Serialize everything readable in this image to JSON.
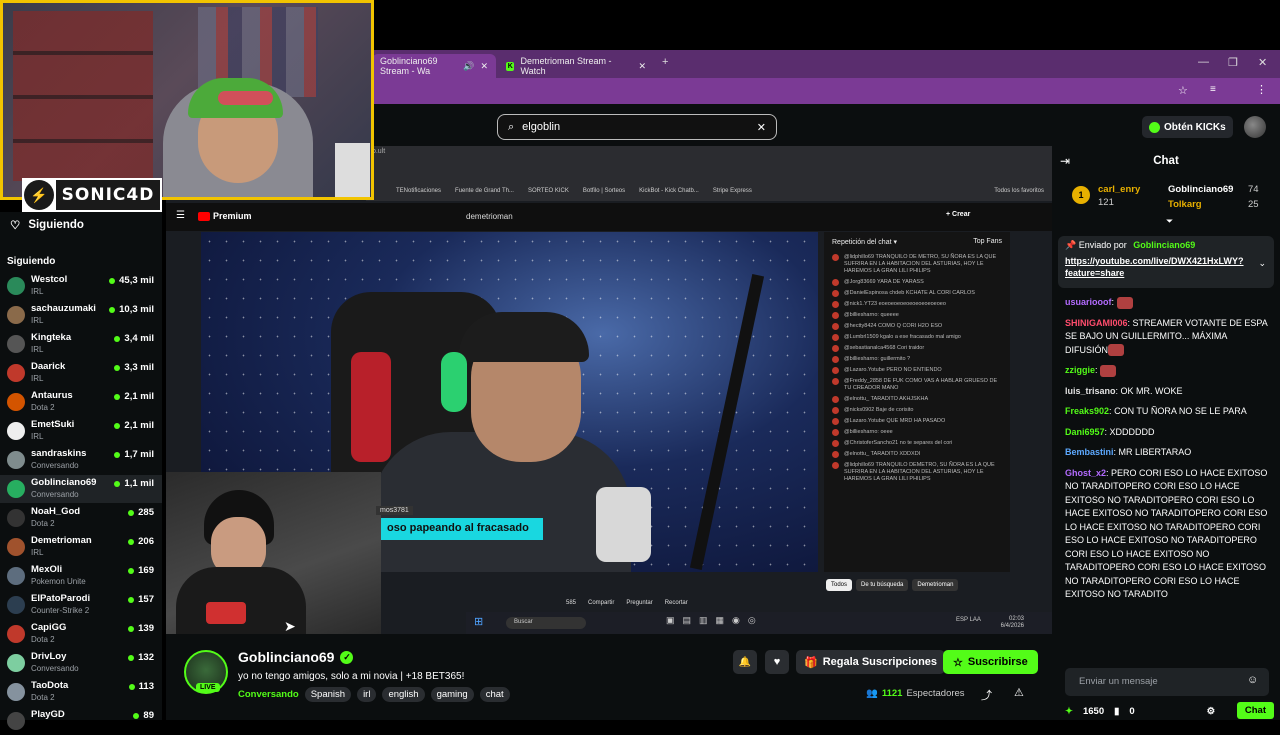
{
  "browser": {
    "tab1_title": "Goblinciano69 Stream - Wa",
    "tab2_title": "Demetrioman Stream - Watch",
    "new_tab": "+",
    "minimize": "—",
    "maximize": "❐",
    "close": "✕"
  },
  "kick": {
    "search_value": "elgoblin",
    "get_kicks": "Obtén KICKs"
  },
  "overlay": {
    "logo_text": "SONIC4D"
  },
  "sidebar": {
    "header": "Siguiendo",
    "subheader": "Siguiendo",
    "channels": [
      {
        "name": "Westcol",
        "category": "IRL",
        "viewers": "45,3 mil",
        "color": "#2a8a5a"
      },
      {
        "name": "sachauzumaki",
        "category": "IRL",
        "viewers": "10,3 mil",
        "color": "#8a6a4a"
      },
      {
        "name": "Kingteka",
        "category": "IRL",
        "viewers": "3,4 mil",
        "color": "#555555"
      },
      {
        "name": "Daarick",
        "category": "IRL",
        "viewers": "3,3 mil",
        "color": "#c0392b"
      },
      {
        "name": "Antaurus",
        "category": "Dota 2",
        "viewers": "2,1 mil",
        "color": "#d35400"
      },
      {
        "name": "EmetSuki",
        "category": "IRL",
        "viewers": "2,1 mil",
        "color": "#eeeeee"
      },
      {
        "name": "sandraskins",
        "category": "Conversando",
        "viewers": "1,7 mil",
        "color": "#7f8c8d"
      },
      {
        "name": "Goblinciano69",
        "category": "Conversando",
        "viewers": "1,1 mil",
        "color": "#27ae60"
      },
      {
        "name": "NoaH_God",
        "category": "Dota 2",
        "viewers": "285",
        "color": "#333333"
      },
      {
        "name": "Demetrioman",
        "category": "IRL",
        "viewers": "206",
        "color": "#a0522d"
      },
      {
        "name": "MexOli",
        "category": "Pokemon Unite",
        "viewers": "169",
        "color": "#5d6d7e"
      },
      {
        "name": "ElPatoParodi",
        "category": "Counter-Strike 2",
        "viewers": "157",
        "color": "#2c3e50"
      },
      {
        "name": "CapiGG",
        "category": "Dota 2",
        "viewers": "139",
        "color": "#c0392b"
      },
      {
        "name": "DrivLoy",
        "category": "Conversando",
        "viewers": "132",
        "color": "#7dcea0"
      },
      {
        "name": "TaoDota",
        "category": "Dota 2",
        "viewers": "113",
        "color": "#85929e"
      },
      {
        "name": "PlayGD",
        "category": "",
        "viewers": "89",
        "color": "#444444"
      }
    ]
  },
  "video": {
    "inner_tab": "tb.ult",
    "bookmarks": [
      "TENotificaciones",
      "Fuente de Grand Th...",
      "SORTEO KICK",
      "Botfilo | Sorteos",
      "KickBot - Kick Chatb...",
      "Stripe Express",
      "Todos los favoritos"
    ],
    "yt_premium": "Premium",
    "yt_search": "demetrioman",
    "yt_crear": "+ Crear",
    "yt_chat_title": "Repetición del chat ▾",
    "yt_top_fans": "Top Fans",
    "yt_chat_messages": [
      "@lidphillo69 TRANQUILO DE METRO, SU ÑORA ES LA QUE SUFRIRA EN LA HABITACION DEL ASTURIAS, HOY LE HAREMOS LA GRAN LILI PHILIPS",
      "@Jorg83669 YARA DE YARASS",
      "@DanielEspinosa chdeb KCHATE AL CORI CARLOS",
      "@nick1.YT23 eoeoeoeoeoeoeoeoeoeoeo",
      "@billiesharno: queeee",
      "@hectty8424 COMO Q CORI H2O ESO",
      "@Lumbrl1509 kgalo a ese fracasado mal amigo",
      "@sebastianalca4568 Cori traidor",
      "@billiesharno: guillermito ?",
      "@Lazaro.Yotube PERO NO ENTIENDO",
      "@Freddy_2858 DE FUK COMO VAS A HABLAR GRUESO DE TU CREADOR MANO",
      "@elnottu_ TARADITO AKHJSKHA",
      "@nicks0902 Baje de corisito",
      "@Lazaro.Yotube QUE MRD HA PASADO",
      "@billiesharno: oeee",
      "@ChristoferSancho21 no te separes del cori",
      "@elnottu_ TARADITO XDDXDI",
      "@lidphillo69 TRANQUILO DEMETRO, SU ÑORA ES LA QUE SUFRIRA EN LA HABITACION DEL ASTURIAS, HOY LE HAREMOS LA GRAN LILI PHILIPS"
    ],
    "yt_filters": [
      "Todos",
      "De tu búsqueda",
      "Demetrioman"
    ],
    "yt_actions": [
      "585",
      "Compartir",
      "Preguntar",
      "Recortar"
    ],
    "caption_top": "mos3781",
    "caption": "oso papeando al fracasado",
    "taskbar_search": "Buscar",
    "taskbar_lang": "ESP LAA",
    "taskbar_time": "02:03",
    "taskbar_date": "6/4/2026"
  },
  "stream": {
    "streamer": "Goblinciano69",
    "live_label": "LIVE",
    "title": "yo no tengo amigos, solo a mi novia | +18 BET365!",
    "category": "Conversando",
    "tags": [
      "Spanish",
      "irl",
      "english",
      "gaming",
      "chat"
    ],
    "gift_label": "Regala Suscripciones",
    "subscribe_label": "Suscribirse",
    "viewers_count": "1121",
    "viewers_label": "Espectadores"
  },
  "chat": {
    "title": "Chat",
    "leader1_name": "carl_enry",
    "leader1_value": "121",
    "leader2_name": "Goblinciano69",
    "leader2_value": "74",
    "leader3_name": "Tolkarg",
    "leader3_value": "25",
    "pinned_label": "Enviado por",
    "pinned_user": "Goblinciano69",
    "pinned_link": "https://youtube.com/live/DWX421HxLWY?feature=share",
    "messages": [
      {
        "user": "usuariooof",
        "color": "#b36bff",
        "text": "",
        "emote": true
      },
      {
        "user": "SHINIGAMI006",
        "color": "#ff4d6d",
        "text": "STREAMER VOTANTE DE ESPA SE BAJO UN GUILLERMITO... MÁXIMA DIFUSIÓN",
        "emote": true
      },
      {
        "user": "zziggie",
        "color": "#53fc18",
        "text": "",
        "emote": true
      },
      {
        "user": "luis_trisano",
        "color": "#e0e0e0",
        "text": "OK MR. WOKE",
        "emote": false
      },
      {
        "user": "Freaks902",
        "color": "#53fc18",
        "text": "CON TU ÑORA NO SE LE PARA",
        "emote": false
      },
      {
        "user": "Dani6957",
        "color": "#53fc18",
        "text": "XDDDDDD",
        "emote": false
      },
      {
        "user": "Bembastini",
        "color": "#5da9ff",
        "text": "MR LIBERTARAO",
        "emote": false
      },
      {
        "user": "Ghost_x2",
        "color": "#b36bff",
        "text": "PERO CORI ESO LO HACE EXITOSO NO TARADITOPERO CORI ESO LO HACE EXITOSO NO TARADITOPERO CORI ESO LO HACE EXITOSO NO TARADITOPERO CORI ESO LO HACE EXITOSO NO TARADITOPERO CORI ESO LO HACE EXITOSO NO TARADITOPERO CORI ESO LO HACE EXITOSO NO TARADITOPERO CORI ESO LO HACE EXITOSO NO TARADITOPERO CORI ESO LO HACE EXITOSO NO TARADITO",
        "emote": false
      }
    ],
    "input_placeholder": "Enviar un mensaje",
    "points": "1650",
    "kicks": "0",
    "chat_button": "Chat"
  },
  "colors": {
    "accent": "#53fc18",
    "bg": "#0b0e0f",
    "browser_purple": "#7b3a95"
  }
}
